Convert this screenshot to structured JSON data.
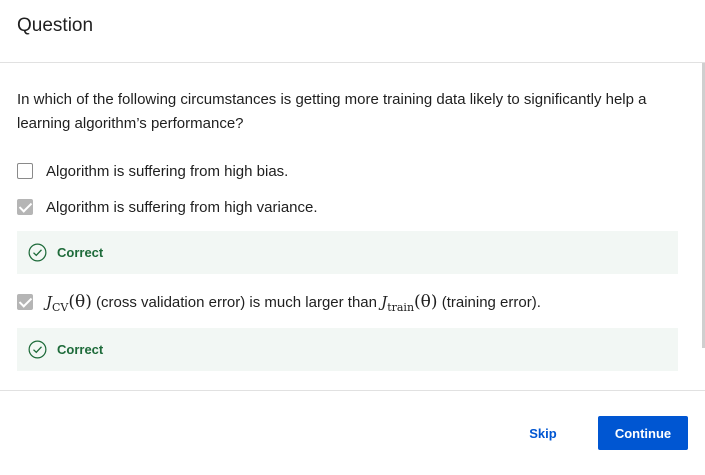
{
  "header": {
    "title": "Question"
  },
  "question": {
    "text": "In which of the following circumstances is getting more training data likely to significantly help a learning algorithm’s performance?"
  },
  "options": [
    {
      "label": "Algorithm is suffering from high bias.",
      "checked": false
    },
    {
      "label": "Algorithm is suffering from high variance.",
      "checked": true,
      "feedback": "Correct"
    },
    {
      "math_a": "J",
      "math_a_sub": "CV",
      "math_a_arg": "(θ)",
      "label_mid": " (cross validation error) is much larger than ",
      "math_b": "J",
      "math_b_sub": "train",
      "math_b_arg": "(θ)",
      "label_end": " (training error).",
      "checked": true,
      "feedback": "Correct"
    }
  ],
  "footer": {
    "skip_label": "Skip",
    "continue_label": "Continue"
  },
  "colors": {
    "accent": "#0056d2",
    "correct": "#1e6b3a",
    "feedback_bg": "#f2f7f4"
  }
}
